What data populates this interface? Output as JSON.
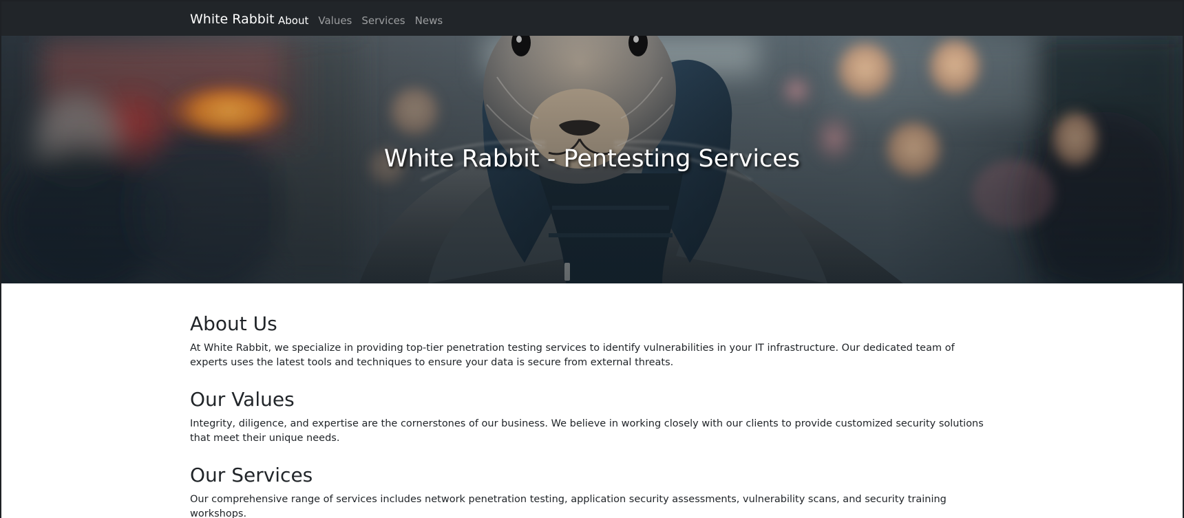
{
  "navbar": {
    "brand": "White Rabbit",
    "links": [
      {
        "label": "About",
        "active": true
      },
      {
        "label": "Values",
        "active": false
      },
      {
        "label": "Services",
        "active": false
      },
      {
        "label": "News",
        "active": false
      }
    ]
  },
  "hero": {
    "title": "White Rabbit - Pentesting Services"
  },
  "sections": [
    {
      "heading": "About Us",
      "text": "At White Rabbit, we specialize in providing top-tier penetration testing services to identify vulnerabilities in your IT infrastructure. Our dedicated team of experts uses the latest tools and techniques to ensure your data is secure from external threats."
    },
    {
      "heading": "Our Values",
      "text": "Integrity, diligence, and expertise are the cornerstones of our business. We believe in working closely with our clients to provide customized security solutions that meet their unique needs."
    },
    {
      "heading": "Our Services",
      "text": "Our comprehensive range of services includes network penetration testing, application security assessments, vulnerability scans, and security training workshops."
    }
  ],
  "colors": {
    "navbar_bg": "#212529",
    "page_bg": "#ffffff",
    "text": "#212529"
  }
}
